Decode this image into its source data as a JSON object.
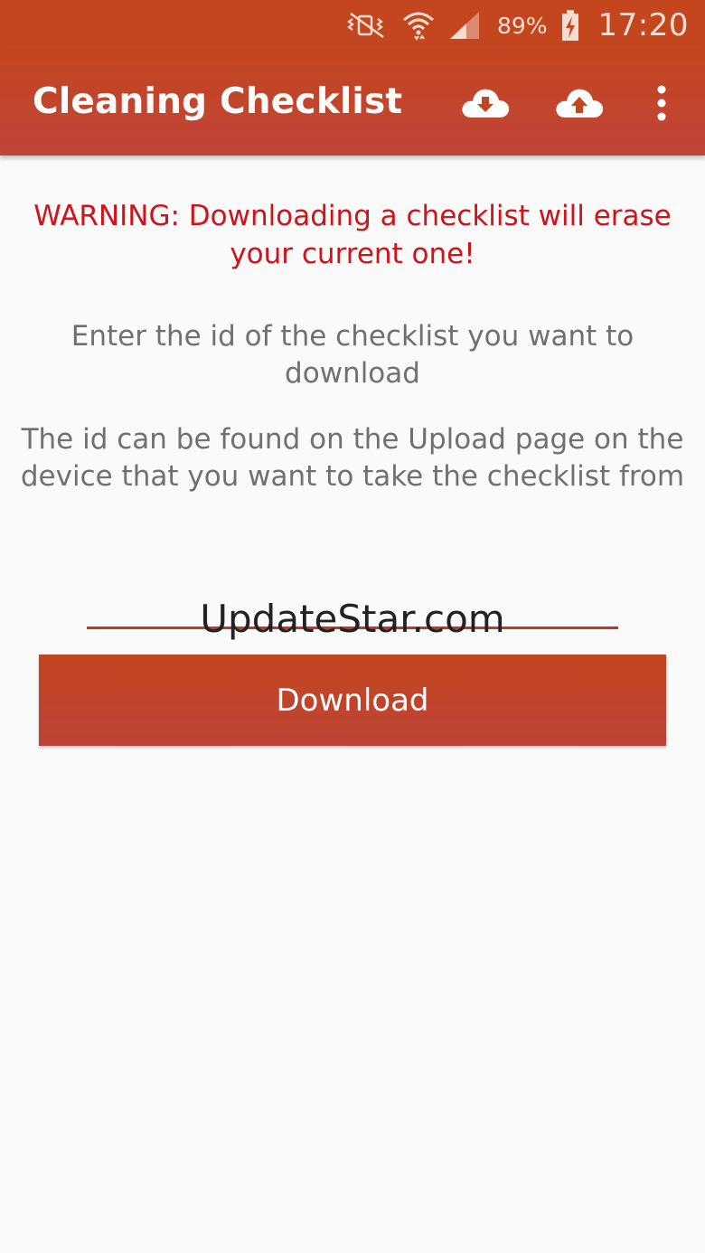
{
  "status_bar": {
    "battery_percent": "89%",
    "time": "17:20",
    "icons": [
      "mute-vibrate-icon",
      "wifi-icon",
      "signal-icon",
      "battery-charging-icon"
    ]
  },
  "app_bar": {
    "title": "Cleaning Checklist",
    "actions": [
      "cloud-download-icon",
      "cloud-upload-icon",
      "more-vert-icon"
    ]
  },
  "content": {
    "warning": "WARNING: Downloading a checklist will erase your current one!",
    "instructions": "Enter the id of the checklist you want to download",
    "hint": "The id can be found on the Upload page on the device that you want to take the checklist from",
    "id_input_value": "UpdateStar.com",
    "download_label": "Download"
  },
  "colors": {
    "primary": "#c4461f",
    "warning_text": "#d0121a",
    "body_text": "#707070",
    "background": "#fafafa"
  }
}
